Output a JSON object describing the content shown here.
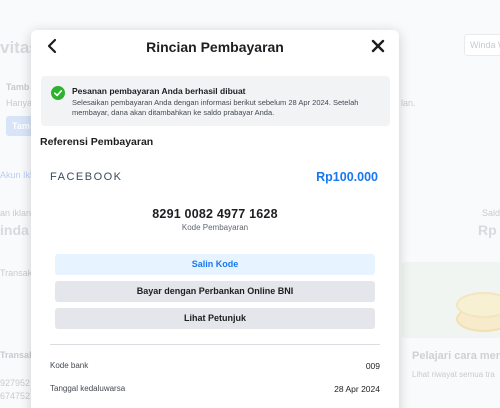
{
  "background": {
    "page_title_fragment": "vitas",
    "section_label": "Tamb",
    "section_text_fragment": "Hanya",
    "button_fragment": "Tam",
    "right_text_fragment": "lan.",
    "account_link_fragment": "Akun Iklan",
    "ads_label_fragment": "an iklan",
    "ads_name_fragment": "inda W",
    "transactions_label_fragment": "Transak",
    "transactions_label_fragment_2": "Transak",
    "number_fragment_1": "927952",
    "number_fragment_2": "674752",
    "search_placeholder": "Winda W",
    "saldo_label_fragment": "Sald",
    "saldo_value_fragment": "Rp",
    "learn_title": "Pelajari cara mem",
    "learn_subtitle": "Lihat riwayat semua tra"
  },
  "modal": {
    "title": "Rincian Pembayaran",
    "notice": {
      "title": "Pesanan pembayaran Anda berhasil dibuat",
      "body": "Selesaikan pembayaran Anda dengan informasi berikut sebelum 28 Apr 2024. Setelah membayar, dana akan ditambahkan ke saldo prabayar Anda."
    },
    "reference_title": "Referensi Pembayaran",
    "merchant": "FACEBOOK",
    "amount": "Rp100.000",
    "payment_code": "8291 0082 4977 1628",
    "payment_code_label": "Kode Pembayaran",
    "buttons": {
      "copy": "Salin Kode",
      "pay_bni": "Bayar dengan Perbankan Online BNI",
      "instructions": "Lihat Petunjuk"
    },
    "details": [
      {
        "label": "Kode bank",
        "value": "009"
      },
      {
        "label": "Tanggal kedaluwarsa",
        "value": "28 Apr 2024"
      }
    ]
  },
  "colors": {
    "accent": "#1877f2",
    "success": "#2eb22e"
  }
}
